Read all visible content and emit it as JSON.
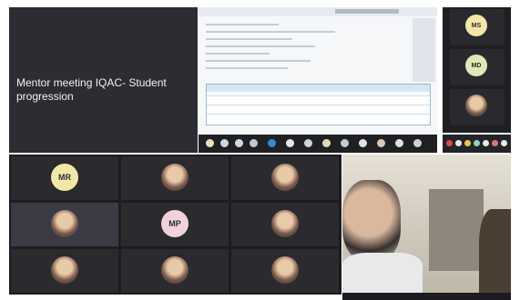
{
  "slide": {
    "title": "Mentor meeting IQAC- Student progression",
    "subtitle": "",
    "meta": []
  },
  "participants": {
    "initials": [
      "MR",
      "MP",
      "MS",
      "MD"
    ]
  },
  "colors": {
    "avatar_yellow": "#f3e7a8",
    "avatar_pink": "#f1d2da",
    "avatar_green": "#dfe8b8",
    "accent_blue": "#2b74c7"
  }
}
